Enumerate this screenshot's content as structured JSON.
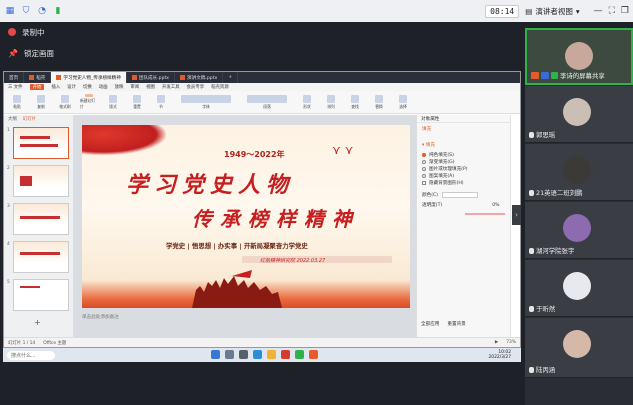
{
  "meeting": {
    "time": "08:14",
    "view_label": "演讲者视图",
    "recording_label": "录制中",
    "mute_label": "锁定画面"
  },
  "window": {
    "tabs": [
      {
        "label": "首页"
      },
      {
        "label": "稻壳"
      },
      {
        "label": "学习党史人物_传承榜样精神"
      },
      {
        "label": "团队成长.pptx"
      },
      {
        "label": "演讲文稿.pptx"
      }
    ],
    "menu": [
      "三 文件",
      "开始",
      "插入",
      "设计",
      "切换",
      "动画",
      "放映",
      "审阅",
      "视图",
      "开发工具",
      "会员专享",
      "稻壳资源"
    ],
    "ribbon": [
      "粘贴",
      "复制",
      "格式刷",
      "新建幻灯片",
      "版式",
      "重置",
      "节",
      "字体",
      "段落",
      "形状",
      "排列",
      "查找",
      "替换",
      "选择"
    ],
    "thumbs_header": [
      "大纲",
      "幻灯片"
    ],
    "notes": "单击此处添加备注",
    "status_left": "幻灯片 1 / 14",
    "status_theme": "Office 主题",
    "zoom": "73%"
  },
  "slide": {
    "years": "1949～2022年",
    "title1": "学习党史人物",
    "title2": "传承榜样精神",
    "subtitle": "学党史 | 悟思想 | 办实事 | 开新局凝聚奋力学党史",
    "org": "红船精神研究院 2022.03.27"
  },
  "side_panel": {
    "header": "对象属性",
    "fill_title": "填充",
    "options": [
      "纯色填充(S)",
      "渐变填充(G)",
      "图片或纹理填充(P)",
      "图案填充(A)",
      "隐藏背景图形(H)"
    ],
    "selected_index": 0,
    "color_label": "颜色(C)",
    "transparency_label": "透明度(T)",
    "transparency_value": "0%",
    "apply_all": "全部应用",
    "reset": "重置背景"
  },
  "taskbar": {
    "search_placeholder": "搜点什么...",
    "clock_time": "10:02",
    "clock_date": "2022/3/27"
  },
  "participants": [
    {
      "name": "李诗的屏幕共享",
      "active": true,
      "avatar_color": "#c7a89a"
    },
    {
      "name": "郭思瑶",
      "active": false,
      "avatar_color": "#cbbfb5"
    },
    {
      "name": "21英语二班刘鹏",
      "active": false,
      "avatar_color": "#3c3a37"
    },
    {
      "name": "湖河学院张宇",
      "active": false,
      "avatar_color": "#8c6bb0"
    },
    {
      "name": "于昕然",
      "active": false,
      "avatar_color": "#e8e8ef"
    },
    {
      "name": "陆丙涵",
      "active": false,
      "avatar_color": "#d6b8a8"
    }
  ]
}
